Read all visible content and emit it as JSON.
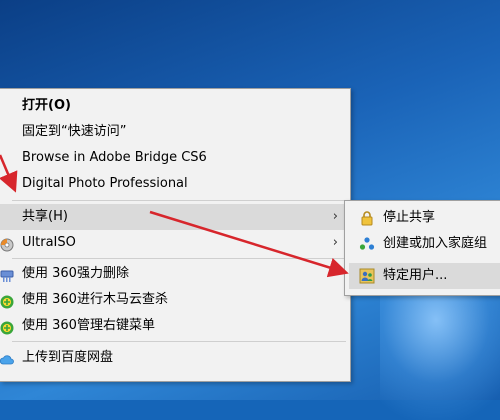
{
  "context_menu": {
    "items": [
      {
        "label": "打开(O)"
      },
      {
        "label": "固定到“快速访问”"
      },
      {
        "label": "Browse in Adobe Bridge CS6"
      },
      {
        "label": "Digital Photo Professional"
      },
      {
        "label": "共享(H)"
      },
      {
        "label": "UltraISO"
      },
      {
        "label": "使用 360强力删除"
      },
      {
        "label": "使用 360进行木马云查杀"
      },
      {
        "label": "使用 360管理右键菜单"
      },
      {
        "label": "上传到百度网盘"
      }
    ]
  },
  "share_submenu": {
    "items": [
      {
        "label": "停止共享",
        "icon": "lock-icon"
      },
      {
        "label": "创建或加入家庭组",
        "icon": "homegroup-icon"
      },
      {
        "label": "特定用户...",
        "icon": "users-icon"
      }
    ]
  },
  "colors": {
    "annotation_arrow": "#d7262c",
    "menu_bg": "#f2f2f2",
    "highlight": "#dadada"
  }
}
